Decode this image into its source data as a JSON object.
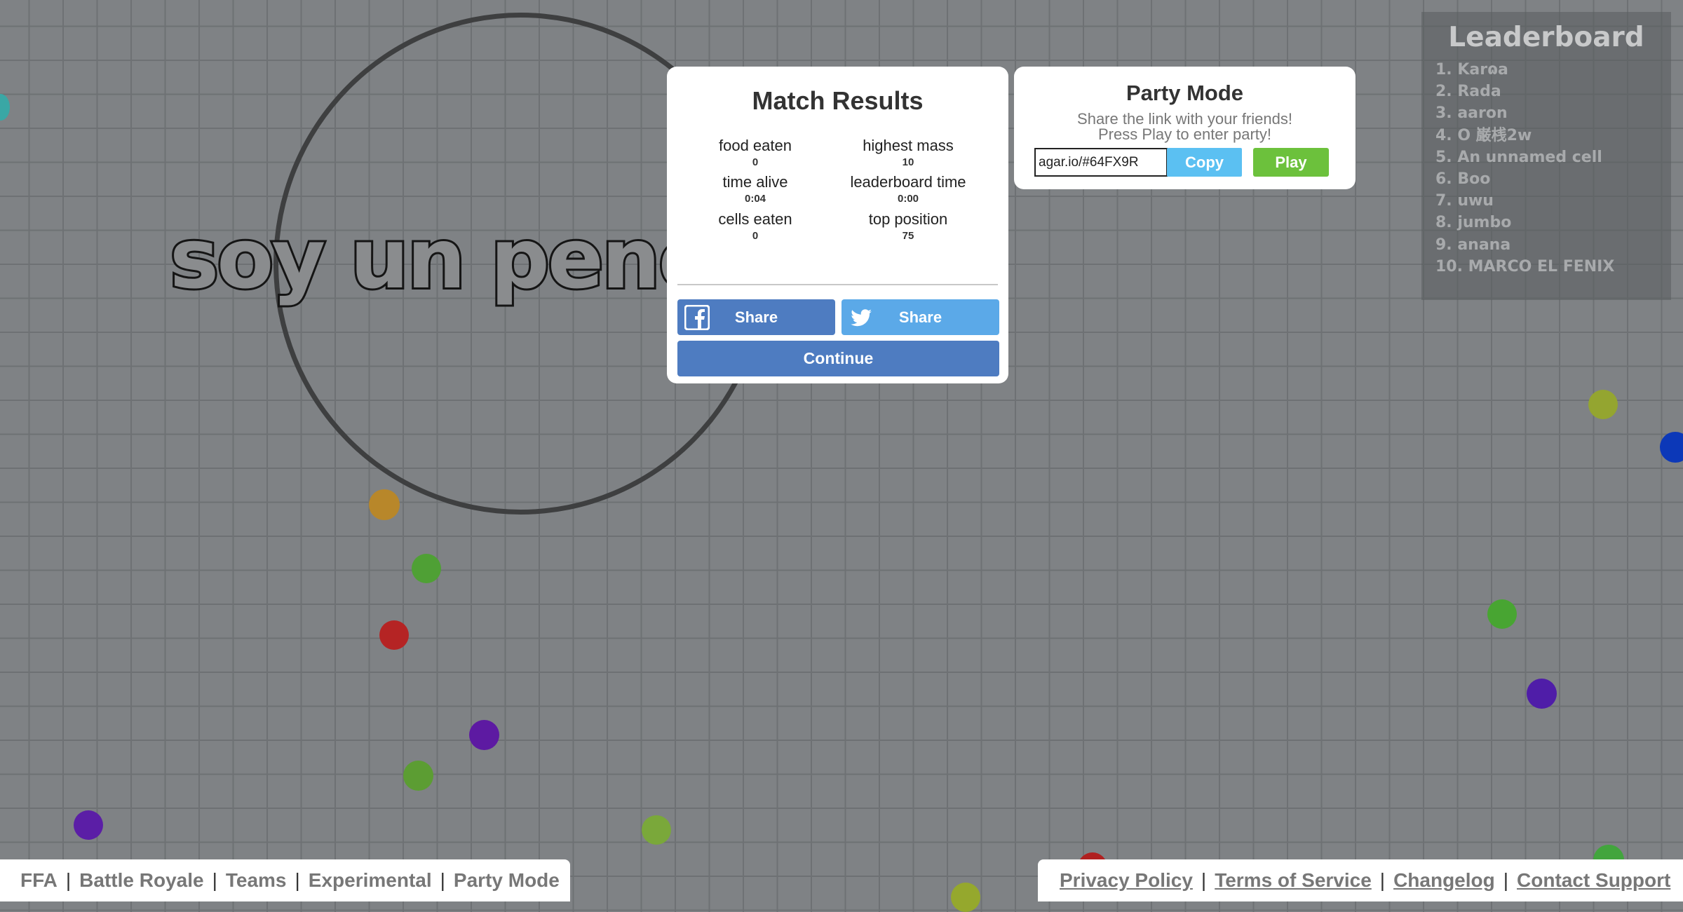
{
  "game": {
    "player_name": "soy un pene"
  },
  "leaderboard": {
    "title": "Leaderboard",
    "entries": [
      "1. Karɷa",
      "2. Rada",
      "3. aaron",
      "4. O 巌桟2w",
      "5. An unnamed cell",
      "6. Boo",
      "7. uwu",
      "8. jumbo",
      "9. anana",
      "10. MARCO EL FENIX"
    ]
  },
  "match_results": {
    "title": "Match Results",
    "stats": [
      {
        "label": "food eaten",
        "value": "0"
      },
      {
        "label": "highest mass",
        "value": "10"
      },
      {
        "label": "time alive",
        "value": "0:04"
      },
      {
        "label": "leaderboard time",
        "value": "0:00"
      },
      {
        "label": "cells eaten",
        "value": "0"
      },
      {
        "label": "top position",
        "value": "75"
      }
    ],
    "facebook_share_label": "Share",
    "twitter_share_label": "Share",
    "continue_label": "Continue"
  },
  "party_mode": {
    "title": "Party Mode",
    "line1": "Share the link with your friends!",
    "line2": "Press Play to enter party!",
    "link_value": "agar.io/#64FX9R",
    "copy_label": "Copy",
    "play_label": "Play"
  },
  "footer_left": {
    "links": [
      "FFA",
      "Battle Royale",
      "Teams",
      "Experimental",
      "Party Mode"
    ],
    "separator": "|"
  },
  "footer_right": {
    "links": [
      "Privacy Policy",
      "Terms of Service",
      "Changelog",
      "Contact Support"
    ],
    "separator": "|"
  },
  "colors": {
    "background": "#7f8285",
    "panel": "#ffffff",
    "facebook_blue": "#4e7cc1",
    "twitter_blue": "#5ba9e8",
    "copy_blue": "#5bc0f2",
    "play_green": "#6cc13c"
  },
  "icons": {
    "facebook": "facebook-icon",
    "twitter": "twitter-icon"
  }
}
